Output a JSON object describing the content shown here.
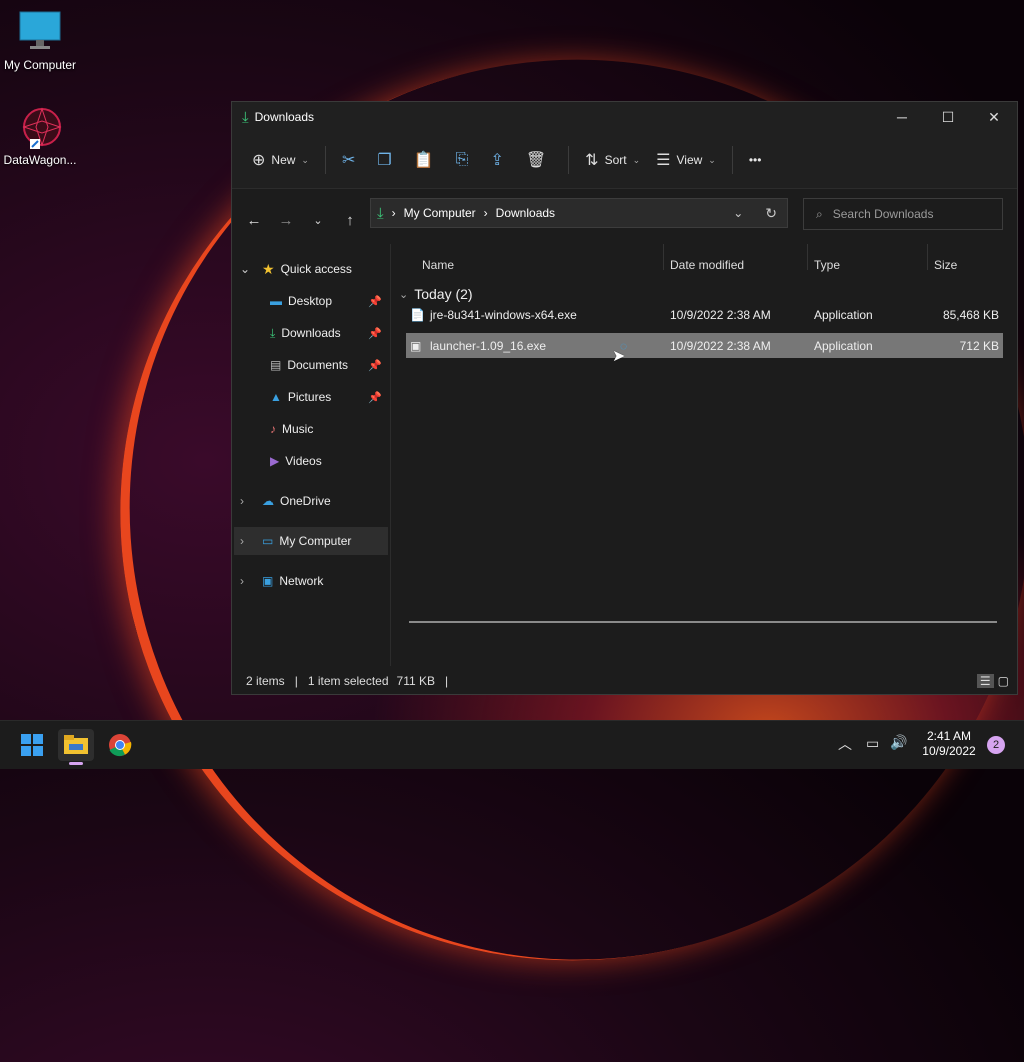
{
  "desktop": {
    "icons": [
      {
        "label": "My Computer"
      },
      {
        "label": "DataWagon..."
      }
    ]
  },
  "window": {
    "title": "Downloads",
    "controls": {
      "minimize": "─",
      "maximize": "☐",
      "close": "✕"
    }
  },
  "toolbar": {
    "new_label": "New",
    "sort_label": "Sort",
    "view_label": "View",
    "more_label": "•••"
  },
  "address": {
    "crumbs": [
      "My Computer",
      "Downloads"
    ]
  },
  "search": {
    "placeholder": "Search Downloads"
  },
  "nav": {
    "quick_access": "Quick access",
    "items": [
      {
        "label": "Desktop"
      },
      {
        "label": "Downloads"
      },
      {
        "label": "Documents"
      },
      {
        "label": "Pictures"
      },
      {
        "label": "Music"
      },
      {
        "label": "Videos"
      }
    ],
    "onedrive": "OneDrive",
    "my_computer": "My Computer",
    "network": "Network"
  },
  "columns": {
    "name": "Name",
    "date": "Date modified",
    "type": "Type",
    "size": "Size"
  },
  "group": {
    "label": "Today (2)"
  },
  "files": [
    {
      "name": "jre-8u341-windows-x64.exe",
      "date": "10/9/2022 2:38 AM",
      "type": "Application",
      "size": "85,468 KB"
    },
    {
      "name": "launcher-1.09_16.exe",
      "date": "10/9/2022 2:38 AM",
      "type": "Application",
      "size": "712 KB"
    }
  ],
  "status": {
    "items": "2 items",
    "selected": "1 item selected",
    "size": "711 KB"
  },
  "taskbar": {
    "time": "2:41 AM",
    "date": "10/9/2022",
    "badge": "2"
  }
}
